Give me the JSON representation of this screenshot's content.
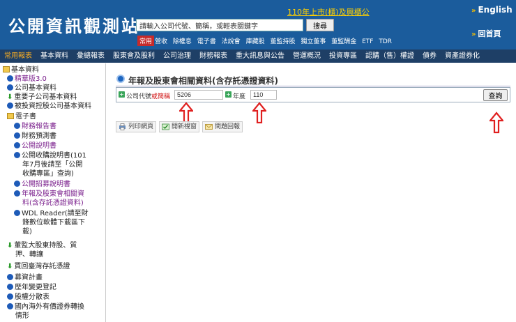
{
  "header": {
    "logo_text": "公開資訊觀測站",
    "top_link": "110年上市(櫃)及興櫃公",
    "search_placeholder": "請輸入公司代號、簡稱，或輕表關鍵字",
    "search_button": "搜尋",
    "common_badge": "常用",
    "quick_links": [
      "營收",
      "除權息",
      "電子書",
      "法說會",
      "庫藏股",
      "董監持股",
      "獨立董事",
      "董監酬金",
      "ETF",
      "TDR"
    ],
    "english": "English",
    "home": "回首頁"
  },
  "nav": {
    "items": [
      "常用報表",
      "基本資料",
      "彙總報表",
      "股東會及股利",
      "公司治理",
      "財務報表",
      "重大訊息與公告",
      "營運概況",
      "投資專區",
      "認購（售）權證",
      "債券",
      "資產證券化"
    ],
    "active_index": 0
  },
  "sidebar": {
    "items": [
      {
        "label": "基本資料",
        "icon": "folder-icon"
      },
      {
        "label": "精華版3.0",
        "icon": "bullet-icon"
      },
      {
        "label": "公司基本資料",
        "icon": "bullet-icon"
      },
      {
        "label": "重要子公司基本資料",
        "icon": "down-arrow-icon"
      },
      {
        "label": "被投資控股公司基本資料",
        "icon": "bullet-icon"
      },
      {
        "label": "電子書",
        "icon": "folder-icon"
      },
      {
        "label": "財務報告書",
        "icon": "bullet-icon"
      },
      {
        "label": "財務預測書",
        "icon": "bullet-icon"
      },
      {
        "label": "公開說明書",
        "icon": "bullet-icon"
      },
      {
        "label": "公開收購說明書(101",
        "icon": "bullet-icon"
      },
      {
        "label": "年7月後請至「公開",
        "icon": ""
      },
      {
        "label": "收購專區」查詢)",
        "icon": ""
      },
      {
        "label": "公開招募說明書",
        "icon": "bullet-icon"
      },
      {
        "label": "年報及股東會相關資",
        "icon": "bullet-icon"
      },
      {
        "label": "料(含存託憑證資料)",
        "icon": ""
      },
      {
        "label": "WDL Reader(請至財",
        "icon": "bullet-icon"
      },
      {
        "label": "鋒數位軟體下載區下",
        "icon": ""
      },
      {
        "label": "載)",
        "icon": ""
      },
      {
        "label": "董監大股東持股、質",
        "icon": "down-arrow-icon"
      },
      {
        "label": "押、轉讓",
        "icon": ""
      },
      {
        "label": "買回臺灣存託憑證",
        "icon": "down-arrow-icon"
      },
      {
        "label": "募資計畫",
        "icon": "bullet-icon"
      },
      {
        "label": "歷年變更登記",
        "icon": "bullet-icon"
      },
      {
        "label": "股權分散表",
        "icon": "bullet-icon"
      },
      {
        "label": "國內海外有價證券轉換",
        "icon": "bullet-icon"
      },
      {
        "label": "情形",
        "icon": ""
      }
    ]
  },
  "main": {
    "title": "年報及股東會相關資料(含存託憑證資料)",
    "company_label": "公司代號",
    "company_label_or": "或簡稱",
    "company_value": "5206",
    "year_label": "年度",
    "year_value": "110",
    "query_button": "查詢",
    "tools": [
      "列印網頁",
      "開新視窗",
      "問題回報"
    ]
  },
  "colors": {
    "header_bg": "#1b5c9c",
    "nav_bg": "#1e3f66",
    "nav_active": "#ffb020",
    "annotation_arrow": "#e02020"
  }
}
